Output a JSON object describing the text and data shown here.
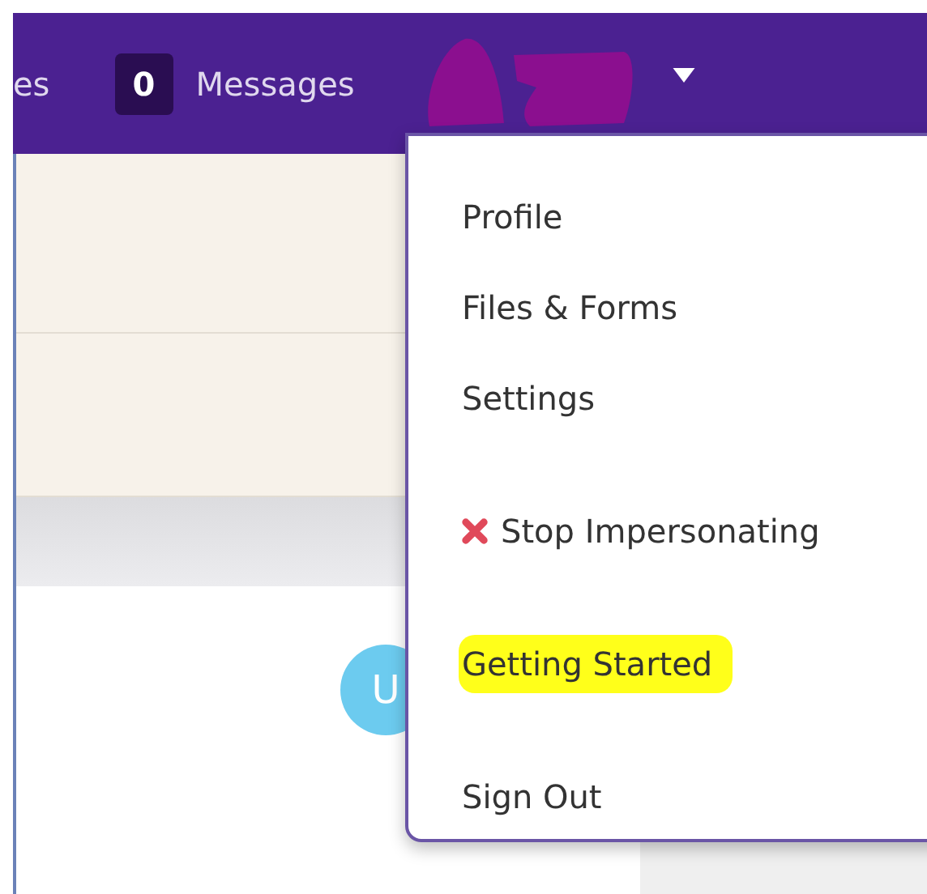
{
  "top_bar": {
    "cut_link": "es",
    "messages": {
      "count": "0",
      "label": "Messages"
    }
  },
  "user_avatar": {
    "initial": "U"
  },
  "user_menu": {
    "expanded": true,
    "items": [
      {
        "kind": "link",
        "label": "Profile",
        "highlighted": false
      },
      {
        "kind": "link",
        "label": "Files & Forms",
        "highlighted": false
      },
      {
        "kind": "link",
        "label": "Settings",
        "highlighted": false
      },
      {
        "kind": "danger",
        "label": "Stop Impersonating",
        "highlighted": false
      },
      {
        "kind": "link",
        "label": "Getting Started",
        "highlighted": true
      },
      {
        "kind": "link",
        "label": "Sign Out",
        "highlighted": false
      }
    ]
  }
}
